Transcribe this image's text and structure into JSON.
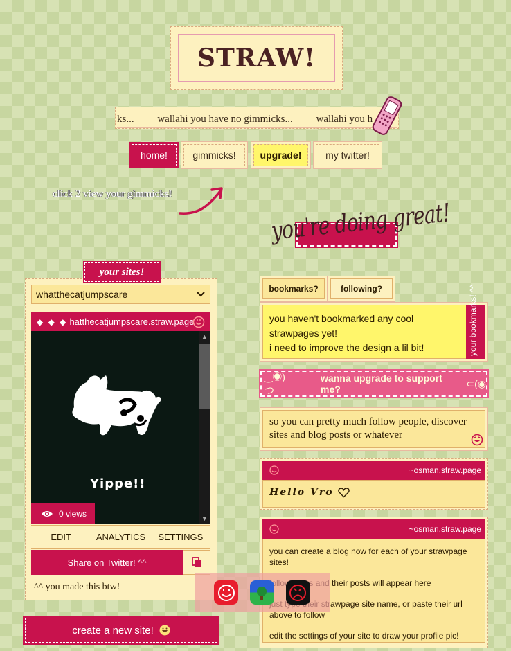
{
  "site_title": "STRAW!",
  "marquee_items": [
    "ks...",
    "wallahi you have no gimmicks...",
    "wallahi you h"
  ],
  "nav": {
    "home": "home!",
    "gimmicks": "gimmicks!",
    "upgrade": "upgrade!",
    "twitter": "my twitter!"
  },
  "click_hint": "click 2 view your gimmicks!",
  "encouragement": "you're doing great!",
  "your_sites": {
    "heading": "your sites!",
    "selected_site": "whatthecatjumpscare",
    "preview_diamonds": "◆ ◆ ◆",
    "preview_url": " hatthecatjumpscare.straw.page",
    "preview_caption": "Yippe!!",
    "views_label": "0 views",
    "actions": [
      "EDIT",
      "ANALYTICS",
      "SETTINGS"
    ],
    "share_label": "Share on Twitter! ^^",
    "made_note": "^^ you made this btw!",
    "create_label": "create a new site!"
  },
  "tabs": {
    "bookmarks": "bookmarks?",
    "following": "following?"
  },
  "bookmarks": {
    "line1": "you haven't bookmarked any cool strawpages yet!",
    "line2": "i need to improve the design a lil bit!",
    "side_label": "your bookmarks! ^^"
  },
  "upgrade_bar": {
    "left_face": "‿◉)つ",
    "label": "wanna upgrade to support me?",
    "right_face": "⊂(◉"
  },
  "follow_info": "so you can pretty much follow people, discover sites and blog posts or whatever",
  "posts": [
    {
      "author": "~osman.straw.page",
      "text": "Hello Vro"
    },
    {
      "author": "~osman.straw.page",
      "paragraphs": [
        "you can create a blog now for each of your strawpage sites!",
        "follow users and their posts will appear here",
        "just type their strawpage site name, or paste their url above to follow",
        "edit the settings of your site to draw your profile pic!"
      ]
    }
  ],
  "colors": {
    "accent": "#c8124d",
    "cream": "#fdf1bf",
    "yellow": "#fff66b",
    "background": "#d7e2b4"
  },
  "icons": [
    "phone-icon",
    "arrow-icon",
    "chevron-down-icon",
    "smiley-icon",
    "eye-icon",
    "copy-icon",
    "heart-icon",
    "laughing-face-icon",
    "grin-icon"
  ]
}
